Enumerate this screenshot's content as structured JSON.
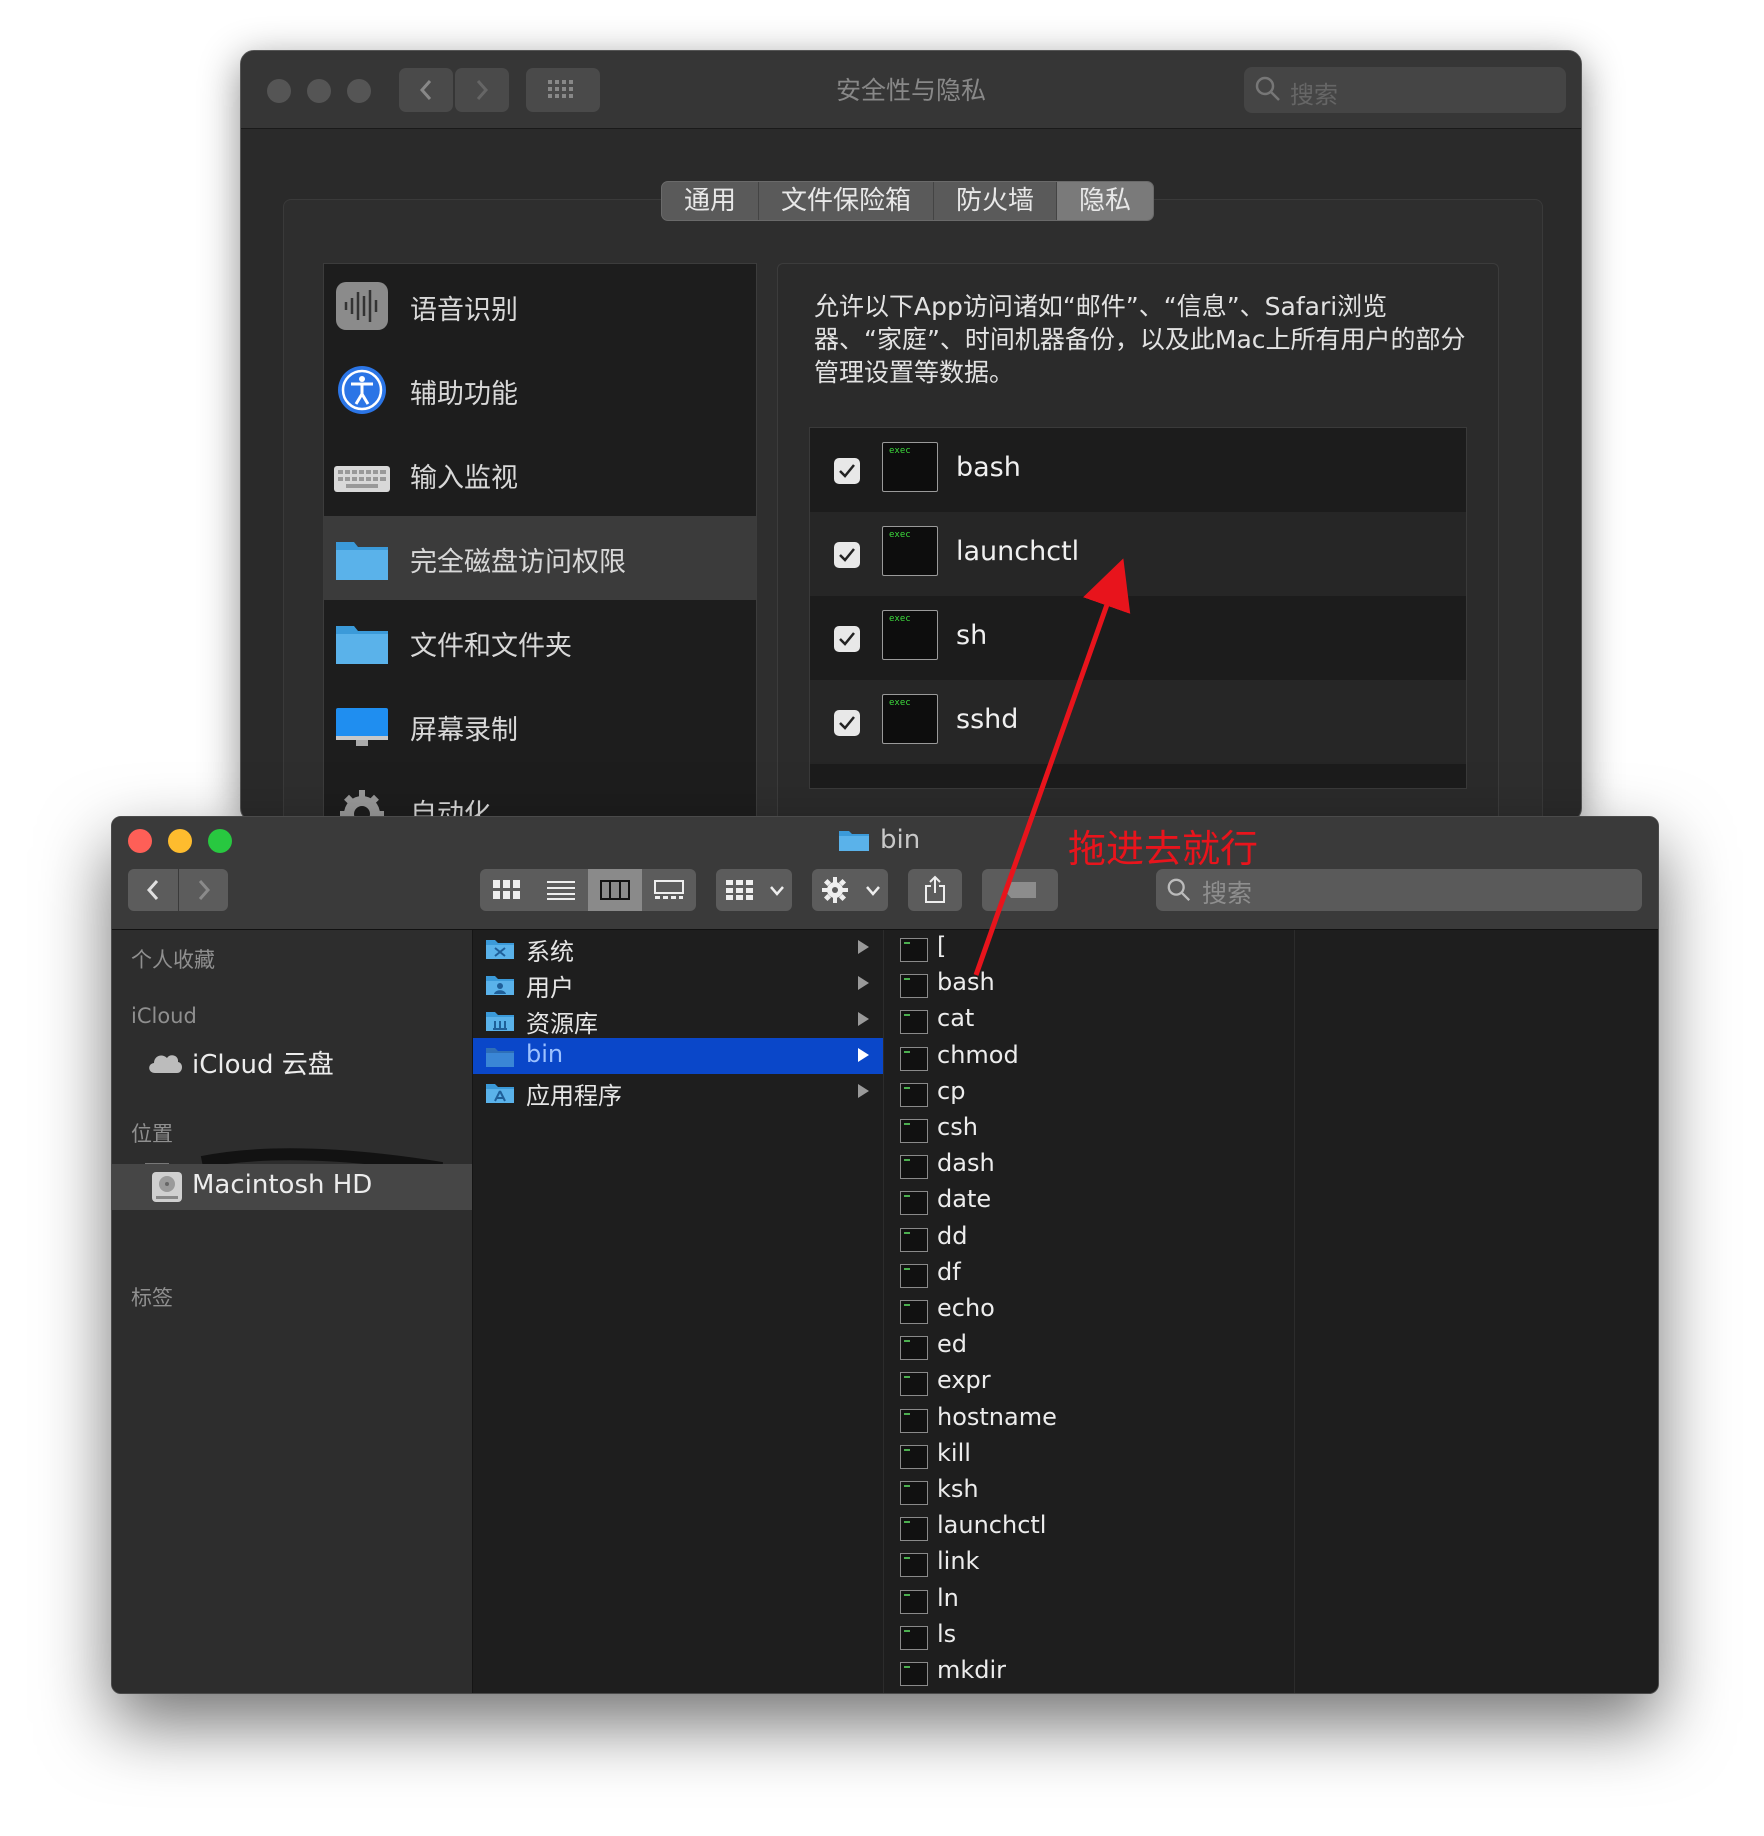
{
  "preferences": {
    "title": "安全性与隐私",
    "search_placeholder": "搜索",
    "tabs": [
      {
        "label": "通用",
        "active": false
      },
      {
        "label": "文件保险箱",
        "active": false
      },
      {
        "label": "防火墙",
        "active": false
      },
      {
        "label": "隐私",
        "active": true
      }
    ],
    "privacy_categories": [
      {
        "label": "语音识别",
        "icon": "speech-recognition-icon",
        "selected": false
      },
      {
        "label": "辅助功能",
        "icon": "accessibility-icon",
        "selected": false
      },
      {
        "label": "输入监视",
        "icon": "keyboard-icon",
        "selected": false
      },
      {
        "label": "完全磁盘访问权限",
        "icon": "folder-icon",
        "selected": true
      },
      {
        "label": "文件和文件夹",
        "icon": "folder-icon",
        "selected": false
      },
      {
        "label": "屏幕录制",
        "icon": "display-icon",
        "selected": false
      },
      {
        "label": "自动化",
        "icon": "gear-icon",
        "selected": false
      }
    ],
    "description": "允许以下App访问诸如“邮件”、“信息”、Safari浏览器、“家庭”、时间机器备份，以及此Mac上所有用户的部分管理设置等数据。",
    "apps": [
      {
        "name": "bash",
        "checked": true,
        "icon_text": "exec"
      },
      {
        "name": "launchctl",
        "checked": true,
        "icon_text": "exec"
      },
      {
        "name": "sh",
        "checked": true,
        "icon_text": "exec"
      },
      {
        "name": "sshd",
        "checked": true,
        "icon_text": "exec"
      }
    ]
  },
  "finder": {
    "title": "bin",
    "search_placeholder": "搜索",
    "sidebar": {
      "favorites_header": "个人收藏",
      "icloud_header": "iCloud",
      "icloud_drive": "iCloud 云盘",
      "locations_header": "位置",
      "macintosh_hd": "Macintosh HD",
      "tags_header": "标签"
    },
    "root_items": [
      {
        "label": "系统",
        "selected": false
      },
      {
        "label": "用户",
        "selected": false
      },
      {
        "label": "资源库",
        "selected": false
      },
      {
        "label": "bin",
        "selected": true
      },
      {
        "label": "应用程序",
        "selected": false
      }
    ],
    "bin_files": [
      "[",
      "bash",
      "cat",
      "chmod",
      "cp",
      "csh",
      "dash",
      "date",
      "dd",
      "df",
      "echo",
      "ed",
      "expr",
      "hostname",
      "kill",
      "ksh",
      "launchctl",
      "link",
      "ln",
      "ls",
      "mkdir"
    ]
  },
  "annotation": {
    "text": "拖进去就行",
    "color": "#e8141c"
  },
  "colors": {
    "selection_blue": "#0a47c9",
    "close_red": "#fe5f57",
    "minimize_yellow": "#febc2e",
    "zoom_green": "#28c840"
  }
}
